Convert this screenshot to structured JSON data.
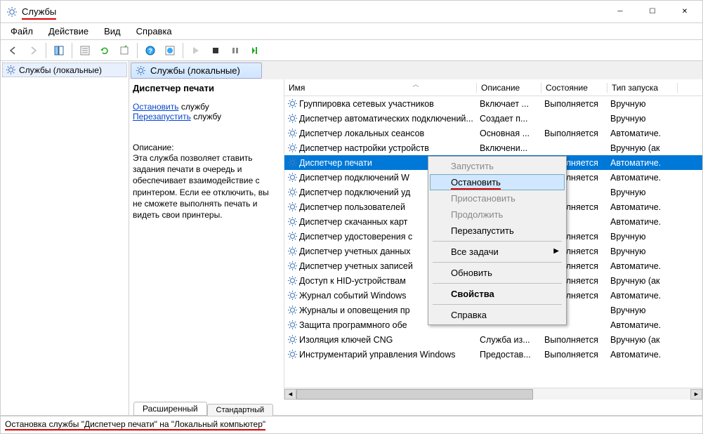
{
  "window": {
    "title": "Службы"
  },
  "menu": {
    "file": "Файл",
    "action": "Действие",
    "view": "Вид",
    "help": "Справка"
  },
  "tree": {
    "root": "Службы (локальные)"
  },
  "header_tab": "Службы (локальные)",
  "detail": {
    "title": "Диспетчер печати",
    "stop_link": "Остановить",
    "stop_suffix": " службу",
    "restart_link": "Перезапустить",
    "restart_suffix": " службу",
    "desc_label": "Описание:",
    "desc": "Эта служба позволяет ставить задания печати в очередь и обеспечивает взаимодействие с принтером. Если ее отключить, вы не сможете выполнять печать и видеть свои принтеры."
  },
  "columns": {
    "name": "Имя",
    "desc": "Описание",
    "state": "Состояние",
    "start": "Тип запуска"
  },
  "services": [
    {
      "name": "Группировка сетевых участников",
      "desc": "Включает ...",
      "state": "Выполняется",
      "start": "Вручную"
    },
    {
      "name": "Диспетчер автоматических подключений...",
      "desc": "Создает п...",
      "state": "",
      "start": "Вручную"
    },
    {
      "name": "Диспетчер локальных сеансов",
      "desc": "Основная ...",
      "state": "Выполняется",
      "start": "Автоматиче."
    },
    {
      "name": "Диспетчер настройки устройств",
      "desc": "Включени...",
      "state": "",
      "start": "Вручную (ак"
    },
    {
      "name": "Диспетчер печати",
      "desc": "",
      "state": "Выполняется",
      "start": "Автоматиче.",
      "selected": true
    },
    {
      "name": "Диспетчер подключений W",
      "desc": "",
      "state": "Выполняется",
      "start": "Автоматиче."
    },
    {
      "name": "Диспетчер подключений уд",
      "desc": "",
      "state": "",
      "start": "Вручную"
    },
    {
      "name": "Диспетчер пользователей",
      "desc": "",
      "state": "Выполняется",
      "start": "Автоматиче."
    },
    {
      "name": "Диспетчер скачанных карт",
      "desc": "",
      "state": "",
      "start": "Автоматиче."
    },
    {
      "name": "Диспетчер удостоверения с",
      "desc": "",
      "state": "Выполняется",
      "start": "Вручную"
    },
    {
      "name": "Диспетчер учетных данных",
      "desc": "",
      "state": "Выполняется",
      "start": "Вручную"
    },
    {
      "name": "Диспетчер учетных записей",
      "desc": "",
      "state": "Выполняется",
      "start": "Автоматиче."
    },
    {
      "name": "Доступ к HID-устройствам",
      "desc": "",
      "state": "Выполняется",
      "start": "Вручную (ак"
    },
    {
      "name": "Журнал событий Windows",
      "desc": "",
      "state": "Выполняется",
      "start": "Автоматиче."
    },
    {
      "name": "Журналы и оповещения пр",
      "desc": "",
      "state": "",
      "start": "Вручную"
    },
    {
      "name": "Защита программного обе",
      "desc": "",
      "state": "",
      "start": "Автоматиче."
    },
    {
      "name": "Изоляция ключей CNG",
      "desc": "Служба из...",
      "state": "Выполняется",
      "start": "Вручную (ак"
    },
    {
      "name": "Инструментарий управления Windows",
      "desc": "Предостав...",
      "state": "Выполняется",
      "start": "Автоматиче."
    }
  ],
  "ctx": {
    "start": "Запустить",
    "stop": "Остановить",
    "pause": "Приостановить",
    "resume": "Продолжить",
    "restart": "Перезапустить",
    "all_tasks": "Все задачи",
    "refresh": "Обновить",
    "props": "Свойства",
    "help": "Справка"
  },
  "tabs": {
    "ext": "Расширенный",
    "std": "Стандартный"
  },
  "status": "Остановка службы \"Диспетчер печати\" на \"Локальный компьютер\""
}
